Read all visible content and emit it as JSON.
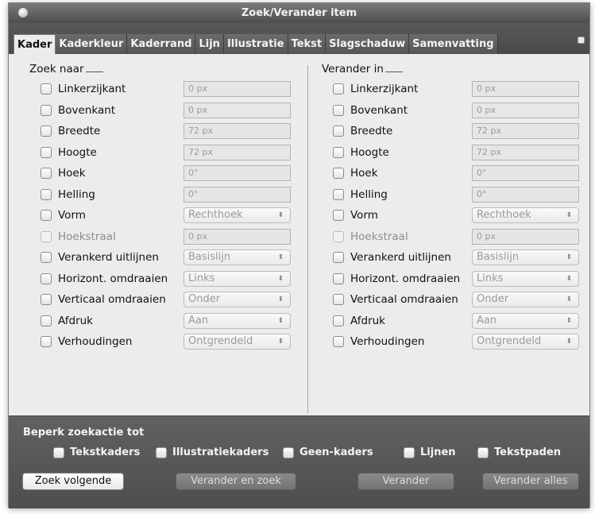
{
  "window": {
    "title": "Zoek/Verander item"
  },
  "tabs": [
    {
      "label": "Kader"
    },
    {
      "label": "Kaderkleur"
    },
    {
      "label": "Kaderrand"
    },
    {
      "label": "Lijn"
    },
    {
      "label": "Illustratie"
    },
    {
      "label": "Tekst"
    },
    {
      "label": "Slagschaduw"
    },
    {
      "label": "Samenvatting"
    }
  ],
  "find": {
    "title": "Zoek naar",
    "rows": [
      {
        "label": "Linkerzijkant",
        "value": "0 px"
      },
      {
        "label": "Bovenkant",
        "value": "0 px"
      },
      {
        "label": "Breedte",
        "value": "72 px"
      },
      {
        "label": "Hoogte",
        "value": "72 px"
      },
      {
        "label": "Hoek",
        "value": "0°"
      },
      {
        "label": "Helling",
        "value": "0°"
      },
      {
        "label": "Vorm",
        "value": "Rechthoek"
      },
      {
        "label": "Hoekstraal",
        "value": "0 px"
      },
      {
        "label": "Verankerd uitlijnen",
        "value": "Basislijn"
      },
      {
        "label": "Horizont. omdraaien",
        "value": "Links"
      },
      {
        "label": "Verticaal omdraaien",
        "value": "Onder"
      },
      {
        "label": "Afdruk",
        "value": "Aan"
      },
      {
        "label": "Verhoudingen",
        "value": "Ontgrendeld"
      }
    ]
  },
  "change": {
    "title": "Verander in",
    "rows": [
      {
        "label": "Linkerzijkant",
        "value": "0 px"
      },
      {
        "label": "Bovenkant",
        "value": "0 px"
      },
      {
        "label": "Breedte",
        "value": "72 px"
      },
      {
        "label": "Hoogte",
        "value": "72 px"
      },
      {
        "label": "Hoek",
        "value": "0°"
      },
      {
        "label": "Helling",
        "value": "0°"
      },
      {
        "label": "Vorm",
        "value": "Rechthoek"
      },
      {
        "label": "Hoekstraal",
        "value": "0 px"
      },
      {
        "label": "Verankerd uitlijnen",
        "value": "Basislijn"
      },
      {
        "label": "Horizont. omdraaien",
        "value": "Links"
      },
      {
        "label": "Verticaal omdraaien",
        "value": "Onder"
      },
      {
        "label": "Afdruk",
        "value": "Aan"
      },
      {
        "label": "Verhoudingen",
        "value": "Ontgrendeld"
      }
    ]
  },
  "limit": {
    "title": "Beperk zoekactie tot",
    "options": [
      {
        "label": "Tekstkaders"
      },
      {
        "label": "Illustratiekaders"
      },
      {
        "label": "Geen-kaders"
      },
      {
        "label": "Lijnen"
      },
      {
        "label": "Tekstpaden"
      }
    ]
  },
  "buttons": {
    "find_next": "Zoek volgende",
    "change_find": "Verander en zoek",
    "change": "Verander",
    "change_all": "Verander alles"
  },
  "colors": {
    "titlebar": "#5e5e5e",
    "panel": "#ececec",
    "bottom_bar": "#575757"
  }
}
